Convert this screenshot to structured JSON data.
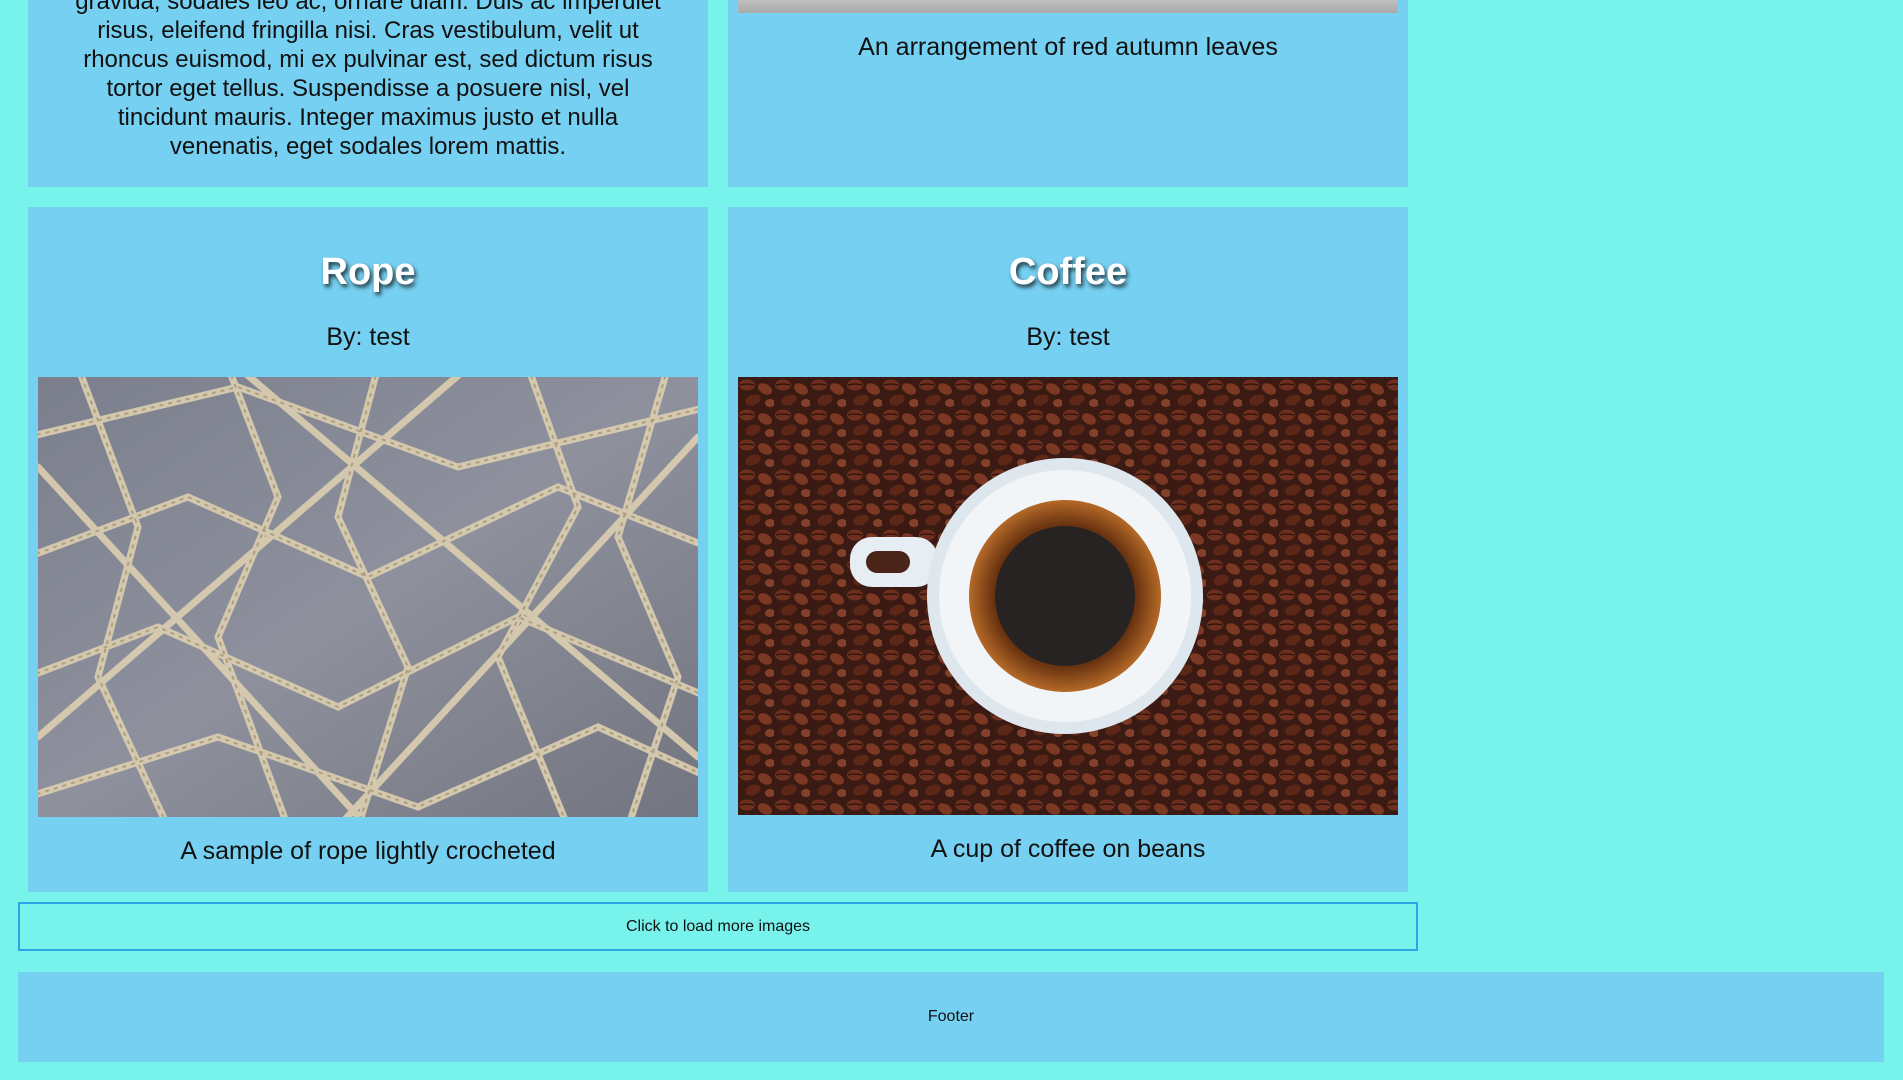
{
  "top_cards": {
    "left_text": "gravida, sodales leo ac, ornare diam. Duis ac imperdiet risus, eleifend fringilla nisi. Cras vestibulum, velit ut rhoncus euismod, mi ex pulvinar est, sed dictum risus tortor eget tellus. Suspendisse a posuere nisl, vel tincidunt mauris. Integer maximus justo et nulla venenatis, eget sodales lorem mattis.",
    "right_caption": "An arrangement of red autumn leaves"
  },
  "cards": [
    {
      "title": "Rope",
      "author": "By: test",
      "image_icon": "rope-image",
      "caption": "A sample of rope lightly crocheted"
    },
    {
      "title": "Coffee",
      "author": "By: test",
      "image_icon": "coffee-image",
      "caption": "A cup of coffee on beans"
    }
  ],
  "load_more": {
    "label": "Click to load more images"
  },
  "footer": {
    "label": "Footer"
  },
  "colors": {
    "page_background": "#77f3ec",
    "card_background": "#76d0f1",
    "button_border": "#2aa6e6"
  }
}
